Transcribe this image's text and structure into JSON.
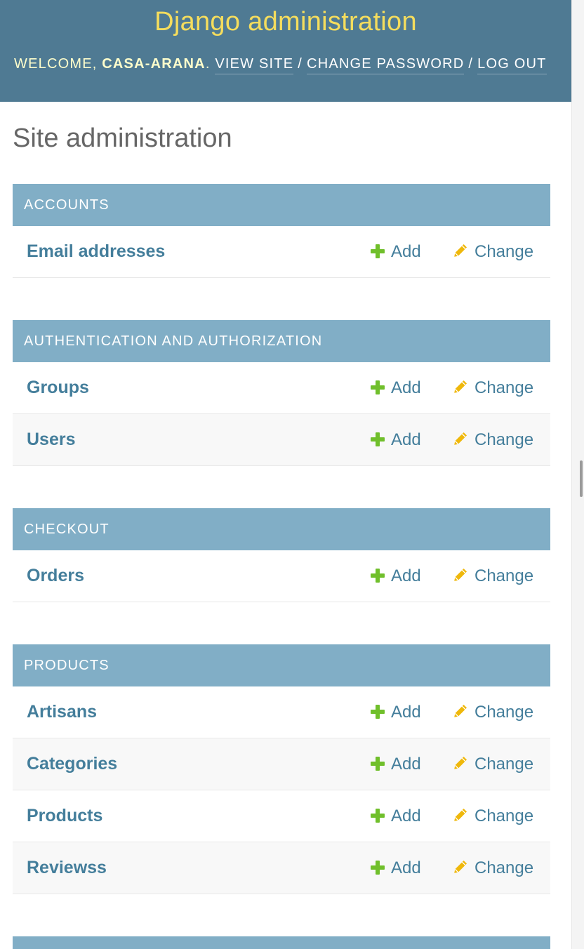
{
  "header": {
    "branding": "Django administration",
    "welcome": "Welcome,",
    "username": "casa-arana",
    "username_suffix": ".",
    "view_site": "View site",
    "change_password": "Change password",
    "log_out": "Log out",
    "separator": "/"
  },
  "page_title": "Site administration",
  "modules": [
    {
      "caption": "Accounts",
      "models": [
        {
          "name": "Email addresses",
          "add": "Add",
          "change": "Change"
        }
      ]
    },
    {
      "caption": "Authentication and Authorization",
      "models": [
        {
          "name": "Groups",
          "add": "Add",
          "change": "Change"
        },
        {
          "name": "Users",
          "add": "Add",
          "change": "Change"
        }
      ]
    },
    {
      "caption": "Checkout",
      "models": [
        {
          "name": "Orders",
          "add": "Add",
          "change": "Change"
        }
      ]
    },
    {
      "caption": "Products",
      "models": [
        {
          "name": "Artisans",
          "add": "Add",
          "change": "Change"
        },
        {
          "name": "Categories",
          "add": "Add",
          "change": "Change"
        },
        {
          "name": "Products",
          "add": "Add",
          "change": "Change"
        },
        {
          "name": "Reviewss",
          "add": "Add",
          "change": "Change"
        }
      ]
    }
  ],
  "icons": {
    "add": "plus-icon",
    "change": "pencil-icon"
  },
  "colors": {
    "header_bg": "#4f7a93",
    "branding": "#f5dd5d",
    "caption_bg": "#81aec6",
    "link": "#447e9b",
    "add_icon": "#70bf2b",
    "change_icon": "#efb80b"
  }
}
